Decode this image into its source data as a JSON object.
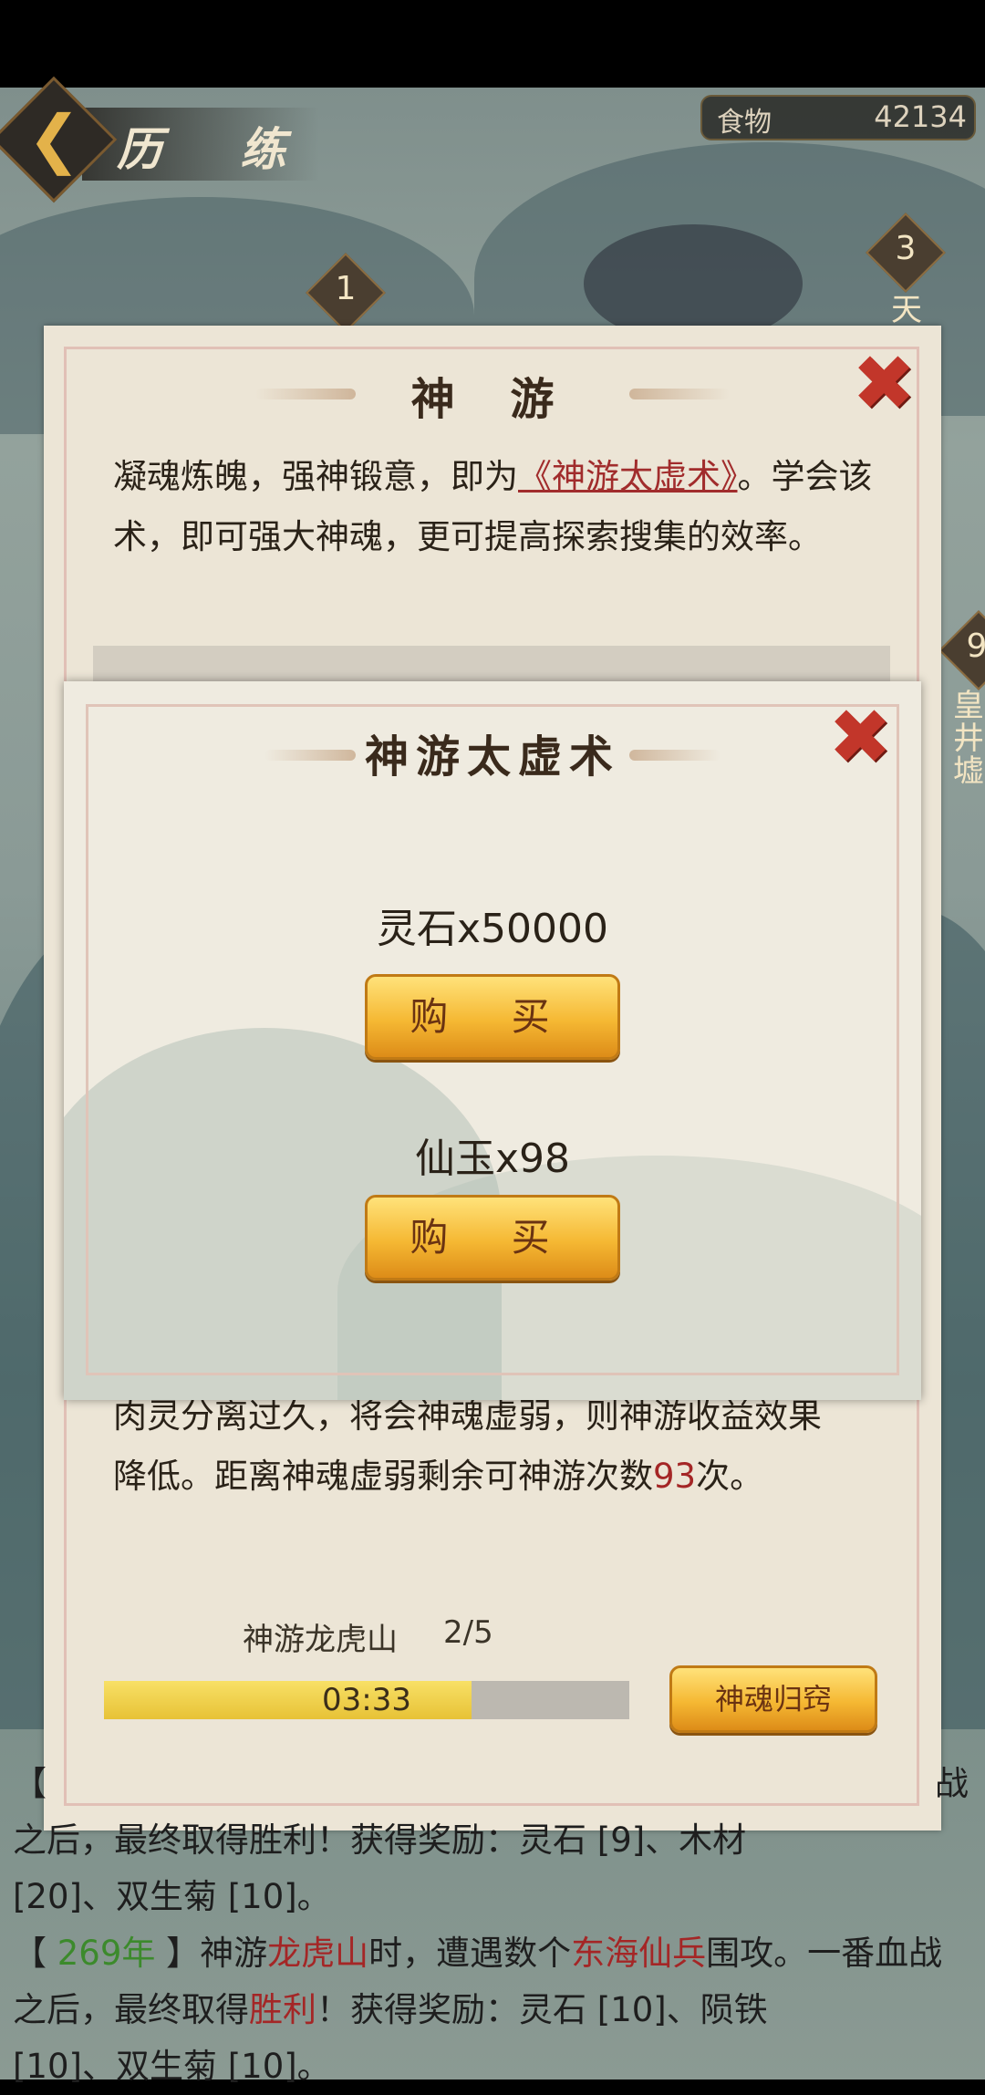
{
  "header": {
    "title": "历 练",
    "food_label": "食物",
    "food_value": "42134"
  },
  "map_nodes": [
    {
      "num": "1",
      "name": ""
    },
    {
      "num": "3",
      "name": "天"
    },
    {
      "num": "9",
      "name": "皇井墟"
    }
  ],
  "panel": {
    "title": "神 游",
    "desc_prefix": "凝魂炼魄，强神锻意，即为",
    "desc_link": "《神游太虚术》",
    "desc_suffix": "。学会该术，即可强大神魂，更可提高探索搜集的效率。",
    "partial_text": "肉灵分离过久，将会神魂虚弱，则神游收益效果",
    "remaining_prefix": "降低。距离神魂虚弱剩余可神游次数",
    "remaining_count": "93",
    "remaining_suffix": "次。",
    "trip_label": "神游龙虎山",
    "trip_count": "2/5",
    "timer": "03:33",
    "progress_fraction": 0.7,
    "return_button": "神魂归窍"
  },
  "log": {
    "line1_left": "【",
    "line1_right": "战",
    "line2": "之后，最终取得胜利！获得奖励：灵石 [9]、木材",
    "line3": "[20]、双生菊 [10]。",
    "entry_open": "【",
    "entry_year": " 269年 ",
    "entry_close": "】",
    "entry_t1": "神游",
    "entry_place": "龙虎山",
    "entry_t2": "时，遭遇数个",
    "entry_enemy": "东海仙兵",
    "entry_t3": "围攻。一番血战",
    "entry_t4": "之后，最终取得",
    "entry_result": "胜利",
    "entry_t5": "！获得奖励：灵石 [10]、陨铁",
    "entry_t6": "[10]、双生菊 [10]。"
  },
  "popup": {
    "title": "神游太虚术",
    "option1_price": "灵石x50000",
    "option1_button": "购 买",
    "option2_price": "仙玉x98",
    "option2_button": "购 买"
  },
  "colors": {
    "accent_red": "#a42626",
    "accent_green": "#3c8a2c",
    "button_gold": "#f5b833"
  },
  "icons": [
    "back-chevron-icon",
    "close-x-icon"
  ]
}
